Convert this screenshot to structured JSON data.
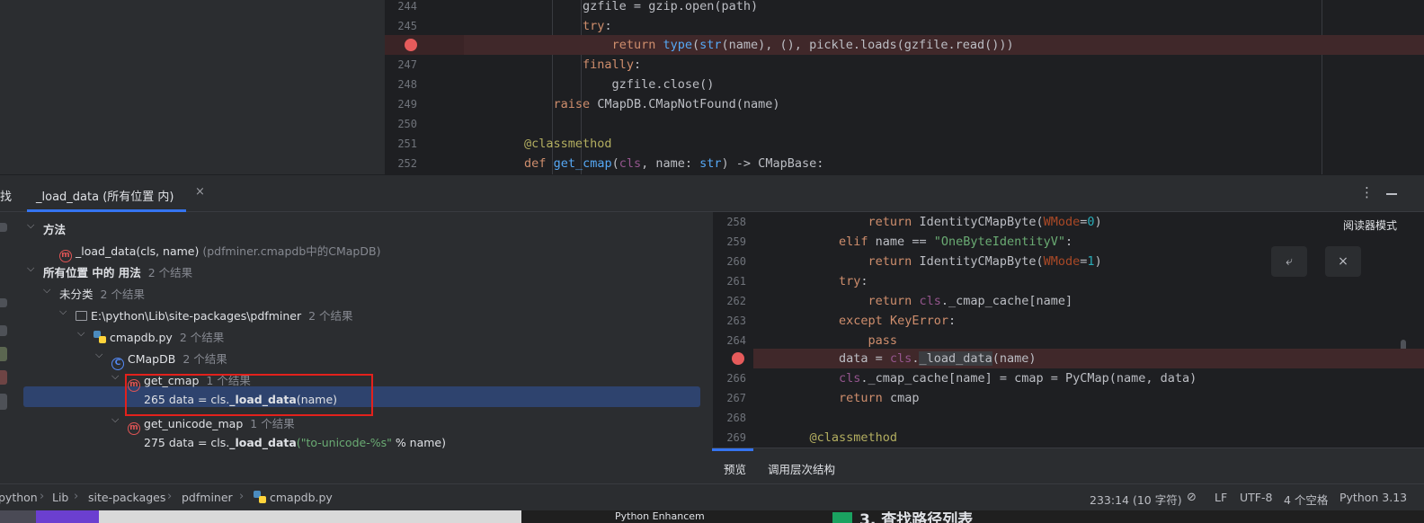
{
  "top_editor": {
    "lines": [
      {
        "no": "244",
        "code": "                gzfile = gzip.open(path)"
      },
      {
        "no": "245",
        "code": "                try:"
      },
      {
        "no": "",
        "code": "                    return type(str(name), (), pickle.loads(gzfile.read()))",
        "breakpoint": true
      },
      {
        "no": "247",
        "code": "                finally:"
      },
      {
        "no": "248",
        "code": "                    gzfile.close()"
      },
      {
        "no": "249",
        "code": "            raise CMapDB.CMapNotFound(name)"
      },
      {
        "no": "250",
        "code": ""
      },
      {
        "no": "251",
        "code": "        @classmethod"
      },
      {
        "no": "252",
        "code": "        def get_cmap(cls, name: str) -> CMapBase:"
      }
    ]
  },
  "find_panel": {
    "label": "找",
    "tab_title": "_load_data (所有位置 内)",
    "close_icon": "×",
    "more_icon": "⋮"
  },
  "tree": {
    "method_header": "方法",
    "method_item": "_load_data(cls, name)",
    "method_item_ctx": "(pdfminer.cmapdb中的CMapDB)",
    "usages_header": "所有位置 中的 用法",
    "usages_count": "2 个结果",
    "uncat_label": "未分类",
    "uncat_count": "2 个结果",
    "folder_label": "E:\\python\\Lib\\site-packages\\pdfminer",
    "folder_count": "2 个结果",
    "file_label": "cmapdb.py",
    "file_count": "2 个结果",
    "class_label": "CMapDB",
    "class_count": "2 个结果",
    "fn1_label": "get_cmap",
    "fn1_count": "1 个结果",
    "usage1_prefix": "265 data = cls.",
    "usage1_bold": "_load_data",
    "usage1_suffix": "(name)",
    "fn2_label": "get_unicode_map",
    "fn2_count": "1 个结果",
    "usage2_prefix": "275 data = cls.",
    "usage2_bold": "_load_data",
    "usage2_str": "(\"to-unicode-%s\"",
    "usage2_suffix": " % name)"
  },
  "preview": {
    "reader_mode": "阅读器模式",
    "wrap_icon": "⤶",
    "close_icon": "×",
    "lines": [
      {
        "no": "258",
        "code": "            return IdentityCMapByte(WMode=0)"
      },
      {
        "no": "259",
        "code": "        elif name == \"OneByteIdentityV\":"
      },
      {
        "no": "260",
        "code": "            return IdentityCMapByte(WMode=1)"
      },
      {
        "no": "261",
        "code": "        try:"
      },
      {
        "no": "262",
        "code": "            return cls._cmap_cache[name]"
      },
      {
        "no": "263",
        "code": "        except KeyError:"
      },
      {
        "no": "264",
        "code": "            pass"
      },
      {
        "no": "",
        "code": "        data = cls._load_data(name)",
        "breakpoint": true
      },
      {
        "no": "266",
        "code": "        cls._cmap_cache[name] = cmap = PyCMap(name, data)"
      },
      {
        "no": "267",
        "code": "        return cmap"
      },
      {
        "no": "268",
        "code": ""
      },
      {
        "no": "269",
        "code": "    @classmethod"
      }
    ],
    "tab_preview": "预览",
    "tab_hierarchy": "调用层次结构"
  },
  "status": {
    "crumbs": [
      "python",
      "Lib",
      "site-packages",
      "pdfminer",
      "cmapdb.py"
    ],
    "position": "233:14 (10 字符)",
    "line_sep": "LF",
    "encoding": "UTF-8",
    "indent": "4 个空格",
    "interpreter": "Python 3.13"
  },
  "taskbar": {
    "item1": "Python Enhancem",
    "item2": "3. 查找路径列表"
  },
  "colors": {
    "accent": "#3574f0",
    "breakpoint": "#e55b5b",
    "annotation_box": "#e3211c"
  }
}
